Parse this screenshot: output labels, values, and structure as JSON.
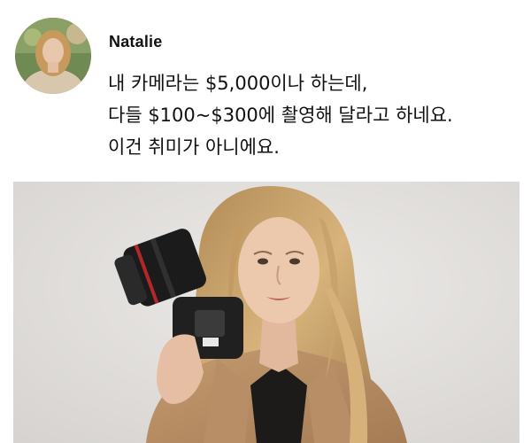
{
  "post": {
    "author": "Natalie",
    "text_lines": [
      "내 카메라는 $5,000이나 하는데,",
      "다들 $100~$300에 촬영해 달라고 하네요.",
      "이건 취미가 아니에요."
    ],
    "photo": "photo of woman holding camera"
  },
  "colors": {
    "text": "#111111",
    "background": "#ffffff",
    "photo_background": "#e5e3e1",
    "blazer": "#b48a62",
    "hair": "#c9a36a"
  }
}
